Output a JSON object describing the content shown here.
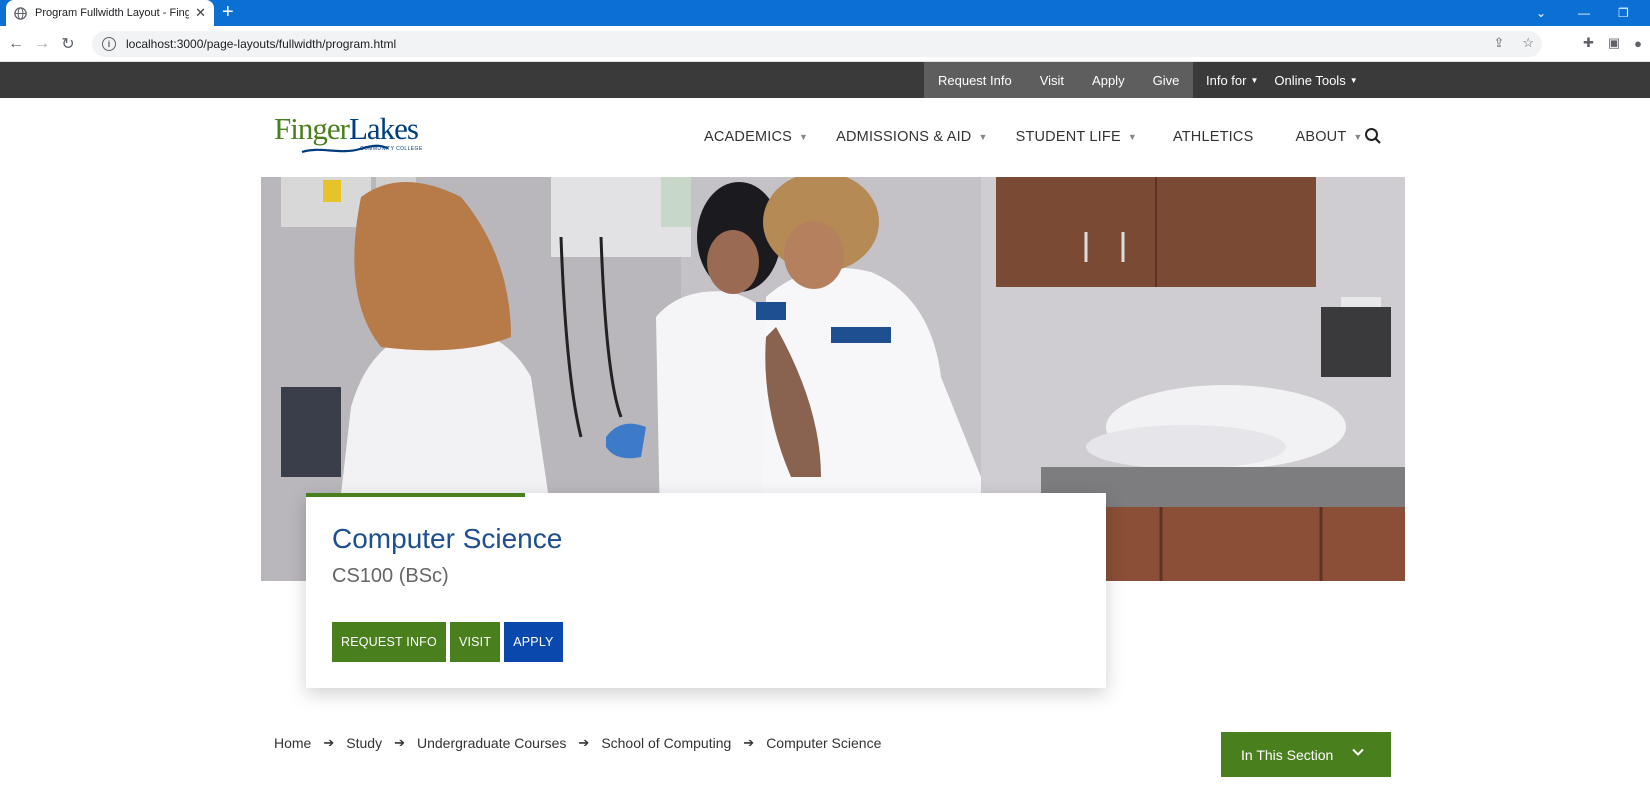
{
  "browser": {
    "tab_title": "Program Fullwidth Layout - Fing",
    "url": "localhost:3000/page-layouts/fullwidth/program.html"
  },
  "utility": {
    "links": [
      "Request Info",
      "Visit",
      "Apply",
      "Give"
    ],
    "dropdowns": [
      "Info for",
      "Online Tools"
    ]
  },
  "logo": {
    "finger": "Finger",
    "lakes": "Lakes",
    "tagline": "COMMUNITY COLLEGE"
  },
  "nav": {
    "items": [
      {
        "label": "ACADEMICS",
        "has_dropdown": true
      },
      {
        "label": "ADMISSIONS & AID",
        "has_dropdown": true
      },
      {
        "label": "STUDENT LIFE",
        "has_dropdown": true
      },
      {
        "label": "ATHLETICS",
        "has_dropdown": false
      },
      {
        "label": "ABOUT",
        "has_dropdown": true
      }
    ]
  },
  "program": {
    "title": "Computer Science",
    "code": "CS100 (BSc)",
    "buttons": [
      "REQUEST INFO",
      "VISIT",
      "APPLY"
    ]
  },
  "breadcrumb": [
    "Home",
    "Study",
    "Undergraduate Courses",
    "School of Computing",
    "Computer Science"
  ],
  "section_menu": {
    "label": "In This Section"
  },
  "colors": {
    "brand_green": "#4a7f1e",
    "brand_blue": "#0b48ad",
    "title_blue": "#1d4f91",
    "utility_bar": "#3a3a3a",
    "chrome_blue": "#0b6fd4"
  }
}
